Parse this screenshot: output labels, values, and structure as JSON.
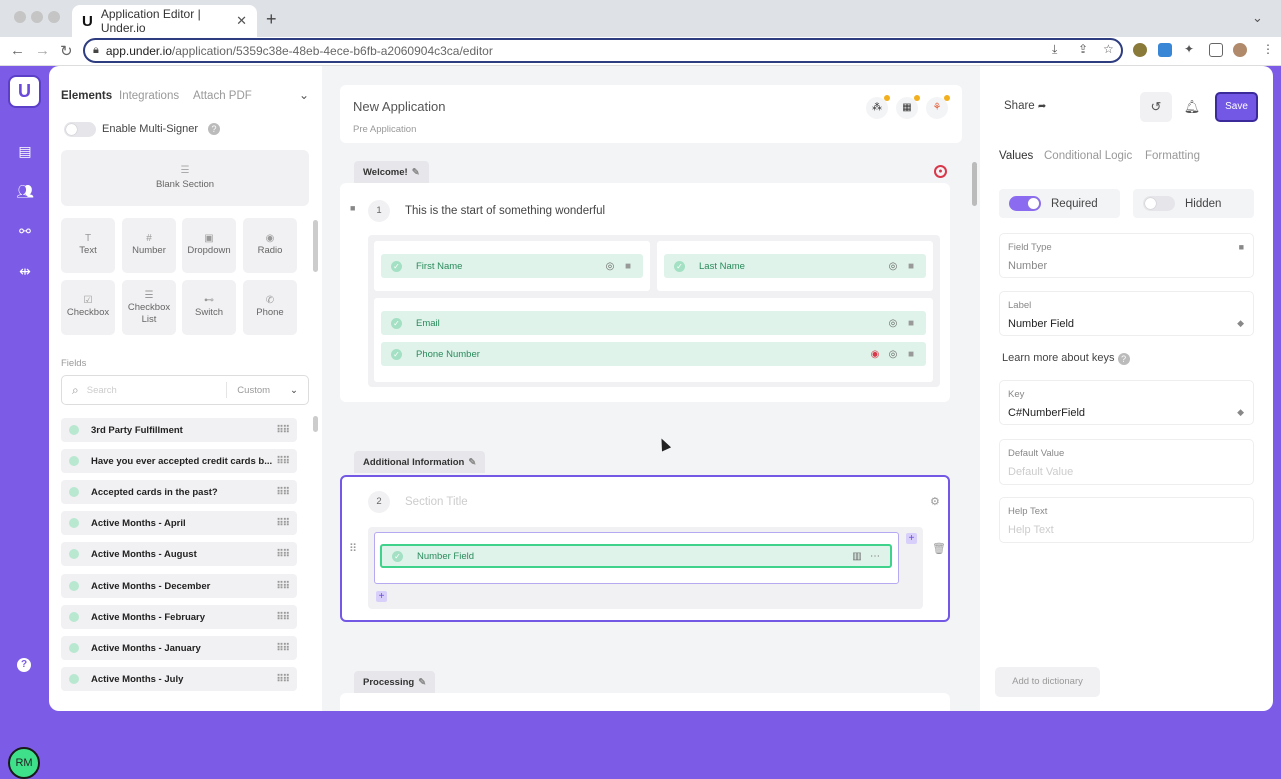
{
  "browser": {
    "tab_title": "Application Editor | Under.io",
    "favicon": "U",
    "url_host": "app.under.io",
    "url_path": "/application/5359c38e-48eb-4ece-b6fb-a2060904c3ca/editor"
  },
  "rail": {
    "logo": "U",
    "help": "?",
    "avatar": "RM"
  },
  "left": {
    "tabs": [
      "Elements",
      "Integrations",
      "Attach PDF"
    ],
    "multi_signer": "Enable Multi-Signer",
    "multi_signer_help": "?",
    "blank_section": "Blank Section",
    "elements": [
      "Text",
      "Number",
      "Dropdown",
      "Radio",
      "Checkbox",
      "Checkbox List",
      "Switch",
      "Phone"
    ],
    "fields_label": "Fields",
    "search_placeholder": "Search",
    "search_filter": "Custom",
    "fields": [
      "3rd Party Fulfillment",
      "Have you ever accepted credit cards b...",
      "Accepted cards in the past?",
      "Active Months - April",
      "Active Months - August",
      "Active Months - December",
      "Active Months - February",
      "Active Months - January",
      "Active Months - July"
    ]
  },
  "middle": {
    "app_title": "New Application",
    "app_subtitle": "Pre Application",
    "section1": {
      "tab": "Welcome!",
      "number": "1",
      "title": "This is the start of something wonderful",
      "fields": {
        "first_name": "First Name",
        "last_name": "Last Name",
        "email": "Email",
        "phone": "Phone Number"
      }
    },
    "section2": {
      "tab": "Additional Information",
      "number": "2",
      "title_placeholder": "Section Title",
      "field": "Number Field"
    },
    "section3": {
      "tab": "Processing"
    }
  },
  "right": {
    "share": "Share",
    "save": "Save",
    "tabs": [
      "Values",
      "Conditional Logic",
      "Formatting"
    ],
    "required": "Required",
    "hidden": "Hidden",
    "field_type_label": "Field Type",
    "field_type_value": "Number",
    "label_label": "Label",
    "label_value": "Number Field",
    "learn_keys": "Learn more about keys",
    "learn_help": "?",
    "key_label": "Key",
    "key_value": "C#NumberField",
    "default_label": "Default Value",
    "default_placeholder": "Default Value",
    "help_label": "Help Text",
    "help_placeholder": "Help Text",
    "add_dictionary": "Add to dictionary"
  },
  "colors": {
    "brand": "#7c5ce6",
    "save": "#7358e6",
    "field_green": "#dff3ea",
    "selected_border": "#3fd28a"
  }
}
